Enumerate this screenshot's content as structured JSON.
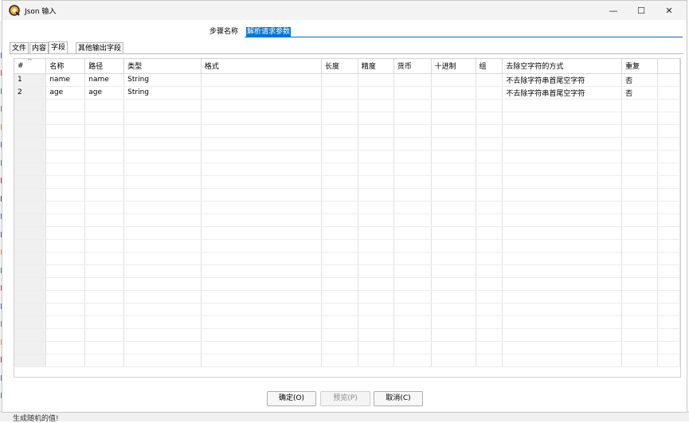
{
  "window": {
    "title": "Json 输入"
  },
  "controls": {
    "minimize": "—",
    "maximize": "☐",
    "close": "✕"
  },
  "step": {
    "label": "步骤名称",
    "value": "解析请求参数"
  },
  "tabs": [
    "文件",
    "内容",
    "字段",
    "其他输出字段"
  ],
  "active_tab": "字段",
  "table": {
    "columns": [
      "#",
      "名称",
      "路径",
      "类型",
      "格式",
      "长度",
      "精度",
      "货币",
      "十进制",
      "组",
      "去除空字符的方式",
      "重复"
    ],
    "rows": [
      [
        "1",
        "name",
        "name",
        "String",
        "",
        "",
        "",
        "",
        "",
        "",
        "不去除字符串首尾空字符",
        "否"
      ],
      [
        "2",
        "age",
        "age",
        "String",
        "",
        "",
        "",
        "",
        "",
        "",
        "不去除字符串首尾空字符",
        "否"
      ]
    ]
  },
  "buttons": {
    "ok": "确定(O)",
    "preview": "预览(P)",
    "cancel": "取消(C)"
  },
  "background": {
    "status_text": "生成随机的值!"
  },
  "colors": {
    "accent": "#0078d7",
    "selection": "#0078d7",
    "title_bg": "#f3f3f3"
  }
}
